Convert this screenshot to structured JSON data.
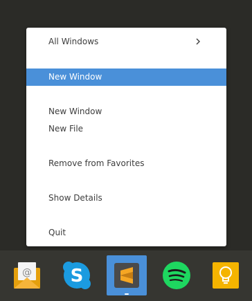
{
  "menu": {
    "all_windows": "All Windows",
    "new_window_highlighted": "New Window",
    "new_window": "New Window",
    "new_file": "New File",
    "remove_favorites": "Remove from Favorites",
    "show_details": "Show Details",
    "quit": "Quit"
  },
  "colors": {
    "highlight": "#4a90d9",
    "menu_background": "#ffffff",
    "dock_background": "#363631",
    "desktop_background": "#2b2b27"
  },
  "dock": {
    "items": [
      {
        "icon": "mail-icon",
        "active": false
      },
      {
        "icon": "skype-icon",
        "active": false
      },
      {
        "icon": "sublime-text-icon",
        "active": true
      },
      {
        "icon": "spotify-icon",
        "active": false
      },
      {
        "icon": "lightbulb-icon",
        "active": false
      }
    ]
  }
}
